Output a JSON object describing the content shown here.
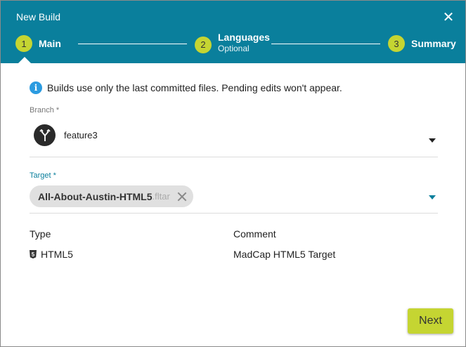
{
  "dialog": {
    "title": "New Build",
    "close_glyph": "✕"
  },
  "steps": [
    {
      "number": "1",
      "label": "Main",
      "sublabel": ""
    },
    {
      "number": "2",
      "label": "Languages",
      "sublabel": "Optional"
    },
    {
      "number": "3",
      "label": "Summary",
      "sublabel": ""
    }
  ],
  "info": {
    "icon": "info-icon",
    "icon_glyph": "i",
    "text": "Builds use only the last committed files. Pending edits won't appear."
  },
  "branch": {
    "label": "Branch *",
    "value": "feature3",
    "icon": "branch-icon"
  },
  "target": {
    "label": "Target *",
    "chip_name": "All-About-Austin-HTML5",
    "chip_ext": ".fltar"
  },
  "details": {
    "type_header": "Type",
    "comment_header": "Comment",
    "type_value": "HTML5",
    "comment_value": "MadCap HTML5 Target",
    "type_icon": "html5-icon",
    "type_icon_glyph": "5"
  },
  "footer": {
    "next_label": "Next"
  },
  "colors": {
    "header": "#0a7f9c",
    "accent": "#c5d532",
    "info": "#2b9be0"
  }
}
